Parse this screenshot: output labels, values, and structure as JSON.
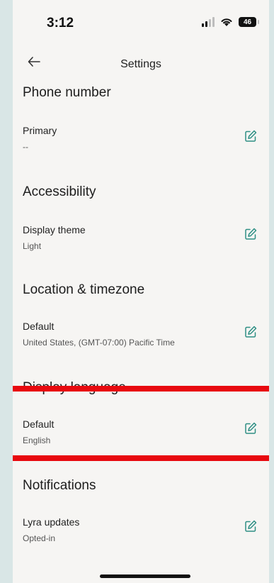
{
  "status": {
    "time": "3:12",
    "battery": "46"
  },
  "header": {
    "title": "Settings",
    "back_icon": "arrow-left-icon"
  },
  "sections": [
    {
      "title": "Phone number",
      "items": [
        {
          "label": "Primary",
          "value": "--"
        }
      ]
    },
    {
      "title": "Accessibility",
      "items": [
        {
          "label": "Display theme",
          "value": "Light"
        }
      ]
    },
    {
      "title": "Location & timezone",
      "items": [
        {
          "label": "Default",
          "value": "United States, (GMT-07:00) Pacific Time"
        }
      ]
    },
    {
      "title": "Display language",
      "items": [
        {
          "label": "Default",
          "value": "English"
        }
      ]
    },
    {
      "title": "Notifications",
      "items": [
        {
          "label": "Lyra updates",
          "value": "Opted-in"
        }
      ]
    }
  ],
  "colors": {
    "accent": "#2f8f84",
    "highlight": "#e8090f",
    "background": "#f6f5f3"
  }
}
